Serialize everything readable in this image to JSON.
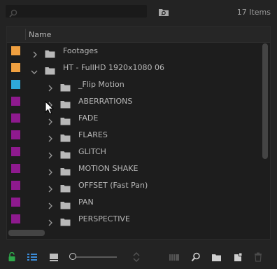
{
  "toolbar": {
    "search_placeholder": "",
    "item_count": "17 Items"
  },
  "columns": {
    "name": "Name"
  },
  "colors": {
    "orange": "#f0a040",
    "cyan": "#2ea8d8",
    "purple": "#8e1a8e",
    "lock_green": "#2ea84a",
    "listview_blue": "#3b8cd8"
  },
  "rows": [
    {
      "label": "Footages",
      "color": "orange",
      "expanded": false,
      "level": 0
    },
    {
      "label": "HT - FullHD 1920x1080 06",
      "color": "orange",
      "expanded": true,
      "level": 0
    },
    {
      "label": "_Flip Motion",
      "color": "cyan",
      "expanded": false,
      "level": 1
    },
    {
      "label": "ABERRATIONS",
      "color": "purple",
      "expanded": false,
      "level": 1
    },
    {
      "label": "FADE",
      "color": "purple",
      "expanded": false,
      "level": 1
    },
    {
      "label": "FLARES",
      "color": "purple",
      "expanded": false,
      "level": 1
    },
    {
      "label": "GLITCH",
      "color": "purple",
      "expanded": false,
      "level": 1
    },
    {
      "label": "MOTION SHAKE",
      "color": "purple",
      "expanded": false,
      "level": 1
    },
    {
      "label": "OFFSET (Fast Pan)",
      "color": "purple",
      "expanded": false,
      "level": 1
    },
    {
      "label": "PAN",
      "color": "purple",
      "expanded": false,
      "level": 1
    },
    {
      "label": "PERSPECTIVE",
      "color": "purple",
      "expanded": false,
      "level": 1
    }
  ],
  "bottom_icons": [
    "lock-icon",
    "list-view-icon",
    "icon-view-icon",
    "zoom-slider",
    "sort-icon",
    "automate-to-sequence-icon",
    "find-icon",
    "new-bin-icon",
    "new-item-icon",
    "clear-icon"
  ]
}
